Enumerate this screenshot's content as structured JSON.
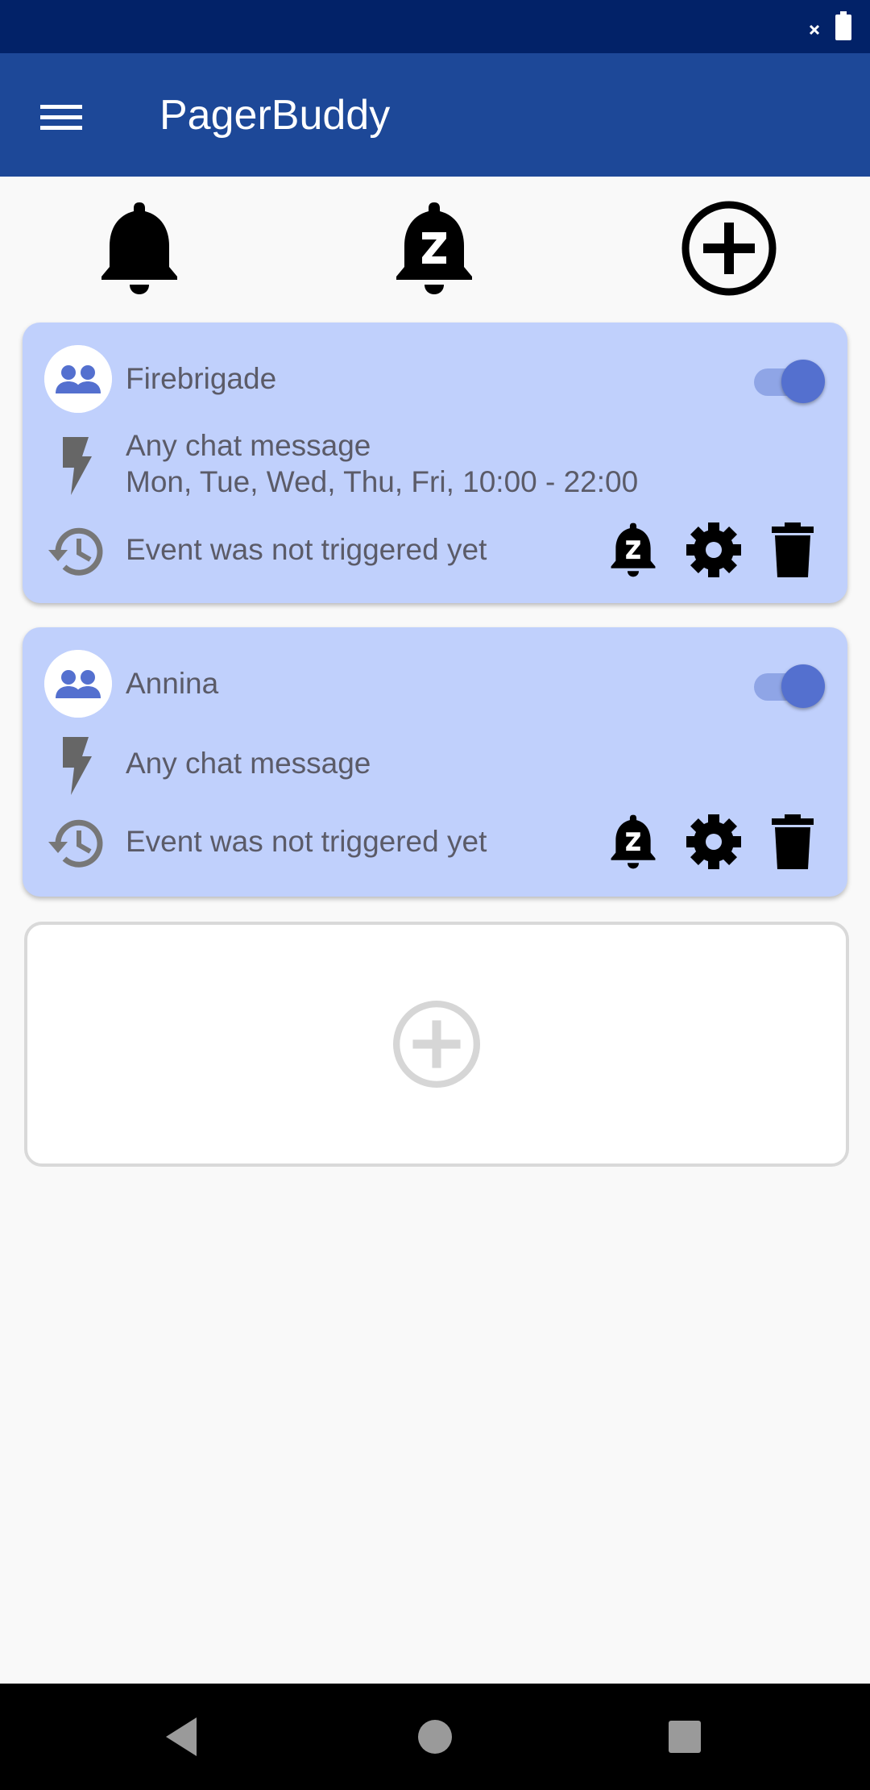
{
  "app": {
    "title": "PagerBuddy"
  },
  "status_bar": {
    "icons": [
      "close-icon",
      "battery-icon"
    ]
  },
  "toolbar": {
    "icons": [
      "bell-icon",
      "snooze-bell-icon",
      "add-circle-icon"
    ]
  },
  "cards": [
    {
      "name": "Firebrigade",
      "enabled": true,
      "trigger_line1": "Any chat message",
      "trigger_line2": "Mon, Tue, Wed, Thu, Fri, 10:00 - 22:00",
      "history": "Event was not triggered yet"
    },
    {
      "name": "Annina",
      "enabled": true,
      "trigger_line1": "Any chat message",
      "history": "Event was not triggered yet"
    }
  ],
  "card_actions": [
    "snooze-bell-icon",
    "gear-icon",
    "trash-icon"
  ],
  "nav_bar": {
    "icons": [
      "back-icon",
      "home-icon",
      "recents-icon"
    ]
  },
  "colors": {
    "status_bar": "#022268",
    "app_bar": "#1d4898",
    "card_background": "#c0d0fc",
    "accent": "#5470cf",
    "toggle_track": "#8fa5e6",
    "text": "#5b5b68"
  }
}
